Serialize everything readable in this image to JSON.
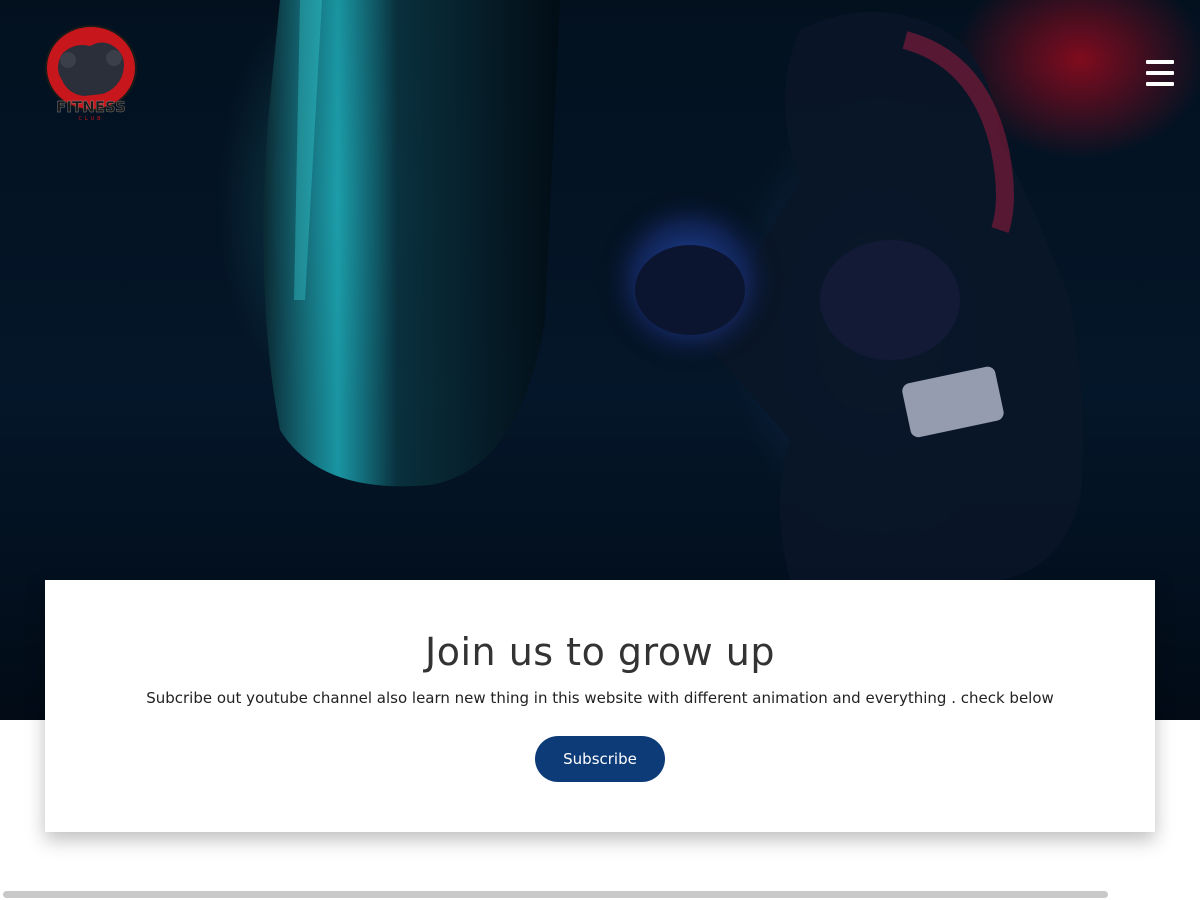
{
  "logo": {
    "brand": "FITNESS",
    "sub": "CLUB",
    "accent": "#c8161d"
  },
  "hero": {
    "icon": "menu-icon"
  },
  "card": {
    "title": "Join us to grow up",
    "description": "Subcribe out youtube channel also learn new thing in this website with different animation and everything . check below",
    "button_label": "Subscribe",
    "button_color": "#0d3b78"
  }
}
